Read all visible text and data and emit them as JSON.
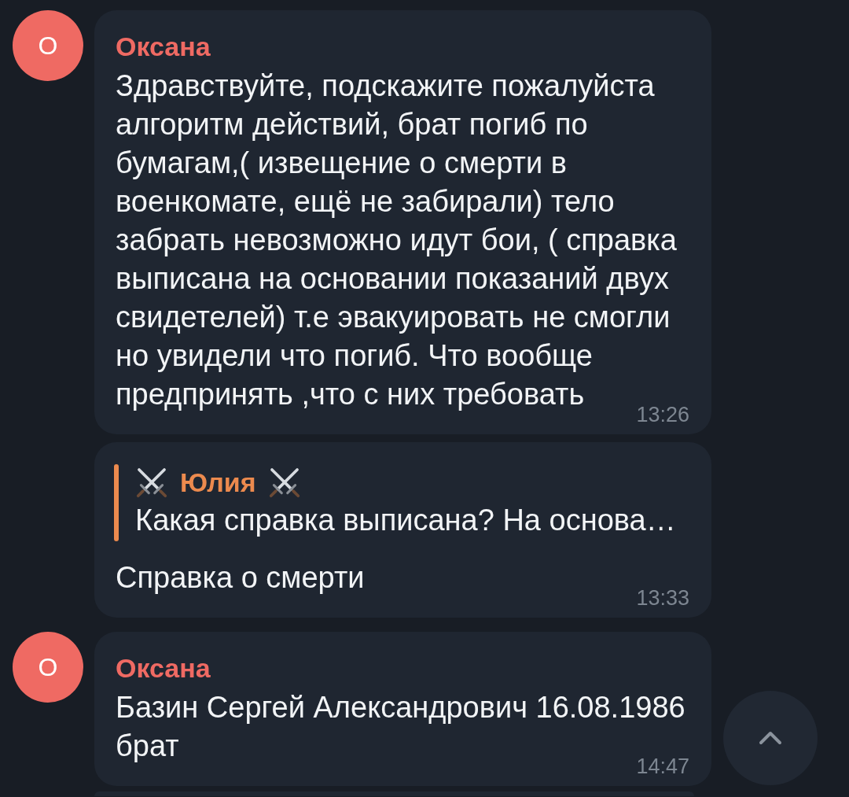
{
  "messages": [
    {
      "avatar": {
        "initial": "О",
        "color": "#ef6a63"
      },
      "sender": "Оксана",
      "text": "Здравствуйте, подскажите пожалуйста алгоритм действий, брат погиб по бумагам,( извещение о смерти в военкомате, ещё не забирали) тело забрать невозможно идут бои, ( справка выписана на основании показаний двух свидетелей) т.е эвакуировать не смогли но увидели что погиб. Что вообще предпринять ,что с них требовать",
      "time": "13:26"
    },
    {
      "reply": {
        "sender": "Юлия",
        "color": "#ec8a4e",
        "text": "Какая справка выписана? На основа…"
      },
      "text": "Справка о смерти",
      "time": "13:33"
    },
    {
      "avatar": {
        "initial": "О",
        "color": "#ef6a63"
      },
      "sender": "Оксана",
      "text": "Базин Сергей Александрович 16.08.1986 брат",
      "time": "14:47"
    }
  ]
}
